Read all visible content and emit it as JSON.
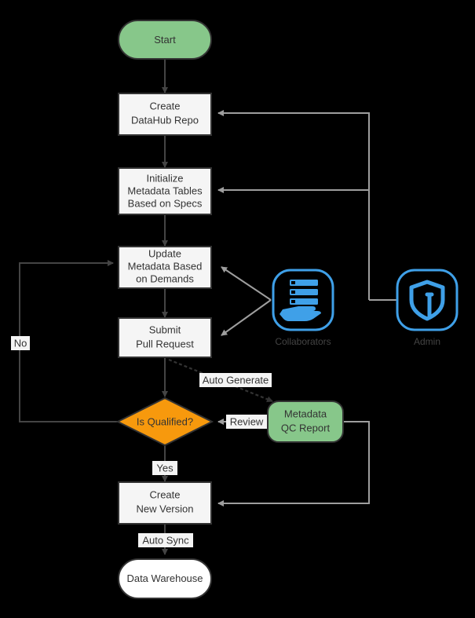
{
  "diagram": {
    "type": "flowchart",
    "background": "#000000",
    "colors": {
      "green": "#87c78a",
      "orange": "#f7990d",
      "box_fill": "#f5f5f5",
      "box_stroke": "#333333",
      "gray_edge": "#9e9e9e",
      "dark_edge": "#444444",
      "actor_blue": "#3fa0e8",
      "white": "#ffffff"
    },
    "nodes": [
      {
        "id": "start",
        "label": "Start",
        "shape": "stadium",
        "fill": "#87c78a"
      },
      {
        "id": "create_repo",
        "label_line1": "Create",
        "label_line2": "DataHub Repo",
        "shape": "rect",
        "fill": "#f5f5f5"
      },
      {
        "id": "init_tables",
        "label_line1": "Initialize",
        "label_line2": "Metadata Tables",
        "label_line3": "Based on Specs",
        "shape": "rect",
        "fill": "#f5f5f5"
      },
      {
        "id": "update_metadata",
        "label_line1": "Update",
        "label_line2": "Metadata Based",
        "label_line3": "on Demands",
        "shape": "rect",
        "fill": "#f5f5f5"
      },
      {
        "id": "submit_pr",
        "label_line1": "Submit",
        "label_line2": "Pull Request",
        "shape": "rect",
        "fill": "#f5f5f5"
      },
      {
        "id": "is_qualified",
        "label": "Is Qualified?",
        "shape": "diamond",
        "fill": "#f7990d"
      },
      {
        "id": "qc_report",
        "label_line1": "Metadata",
        "label_line2": "QC Report",
        "shape": "stadium",
        "fill": "#87c78a"
      },
      {
        "id": "create_version",
        "label_line1": "Create",
        "label_line2": "New Version",
        "shape": "rect",
        "fill": "#f5f5f5"
      },
      {
        "id": "data_warehouse",
        "label": "Data Warehouse",
        "shape": "stadium",
        "fill": "#ffffff"
      }
    ],
    "actors": [
      {
        "id": "collaborators",
        "label": "Collaborators",
        "icon": "hand-holding-documents-icon",
        "color": "#3fa0e8"
      },
      {
        "id": "admin",
        "label": "Admin",
        "icon": "shield-icon",
        "color": "#3fa0e8"
      }
    ],
    "edge_labels": {
      "no": "No",
      "yes": "Yes",
      "auto_generate": "Auto Generate",
      "review": "Review",
      "auto_sync": "Auto Sync"
    }
  }
}
